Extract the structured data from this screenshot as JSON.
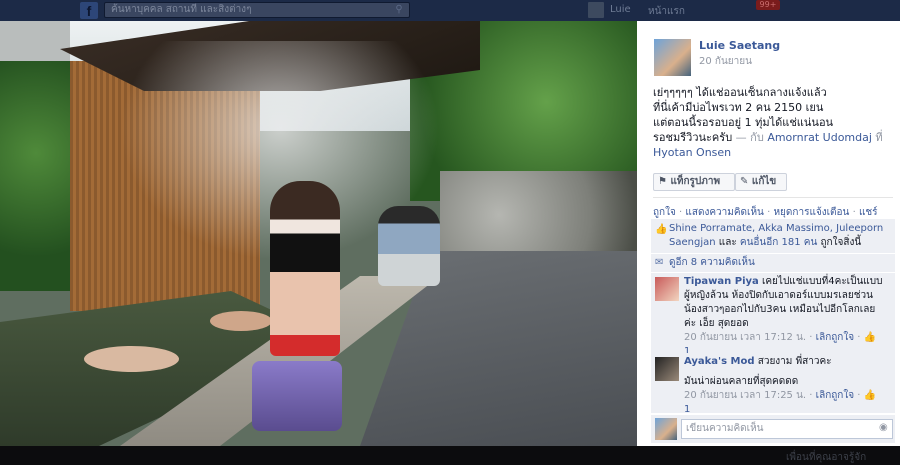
{
  "topbar": {
    "logo": "f",
    "search_placeholder": "ค้นหาบุคคล สถานที่ และสิ่งต่างๆ",
    "user_name": "Luie",
    "home_label": "หน้าแรก",
    "notification_count": "99+"
  },
  "post": {
    "author": "Luie Saetang",
    "date": "20 กันยายน",
    "text_line1": "เย่ๆๆๆๆๆ ได้แช่ออนเซ็นกลางแจ้งแล้ว",
    "text_line2": "ที่นี่เค้ามีบ่อไพรเวท 2 คน 2150 เยน",
    "text_line3": "แต่ตอนนี้รอรอบอยู่ 1 ทุ่มได้แช่แน่นอน",
    "text_line4": "รอชมรีวิวนะครับ",
    "with_prefix": "— กับ",
    "tagged_person": "Amornrat Udomdaj",
    "at_word": "ที่",
    "place": "Hyotan Onsen",
    "tag_photo_label": "แท็กรูปภาพ",
    "edit_label": "แก้ไข",
    "actions": {
      "like": "ถูกใจ",
      "comment": "แสดงความคิดเห็น",
      "stop_notify": "หยุดการแจ้งเตือน",
      "share": "แชร์"
    },
    "likes_text": "Shine Porramate, Akka Massimo, Juleeporn Saengjan",
    "likes_and": "และ",
    "likes_others": "คนอื่นอีก 181 คน",
    "likes_suffix": "ถูกใจสิ่งนี้",
    "view_comments": "ดูอีก 8 ความคิดเห็น"
  },
  "comments": [
    {
      "author": "Tipawan Piya",
      "text": "เคยไปแช่แบบที่4คะเป็นแบบผู้หญิงล้วน ห้องปิดกับเอาดอร์แบบมรเลยช่วนน้องสาวๆออกไปกับ3คน เหมือนไปอีกโลกเลยค่ะ เอ็ย สุดยอด",
      "time": "20 กันยายน เวลา 17:12 น.",
      "like_label": "เลิกถูกใจ",
      "like_count": "1"
    },
    {
      "author": "Ayaka's Mod",
      "text": "สวยงาม พี่สาวคะ",
      "text2": "มันน่าผ่อนคลายที่สุดคดดด",
      "time": "20 กันยายน เวลา 17:25 น.",
      "like_label": "เลิกถูกใจ",
      "like_count": "1"
    }
  ],
  "comment_input": {
    "placeholder": "เขียนความคิดเห็น"
  },
  "bottom": {
    "right_text": "เพื่อนที่คุณอาจรู้จัก"
  }
}
